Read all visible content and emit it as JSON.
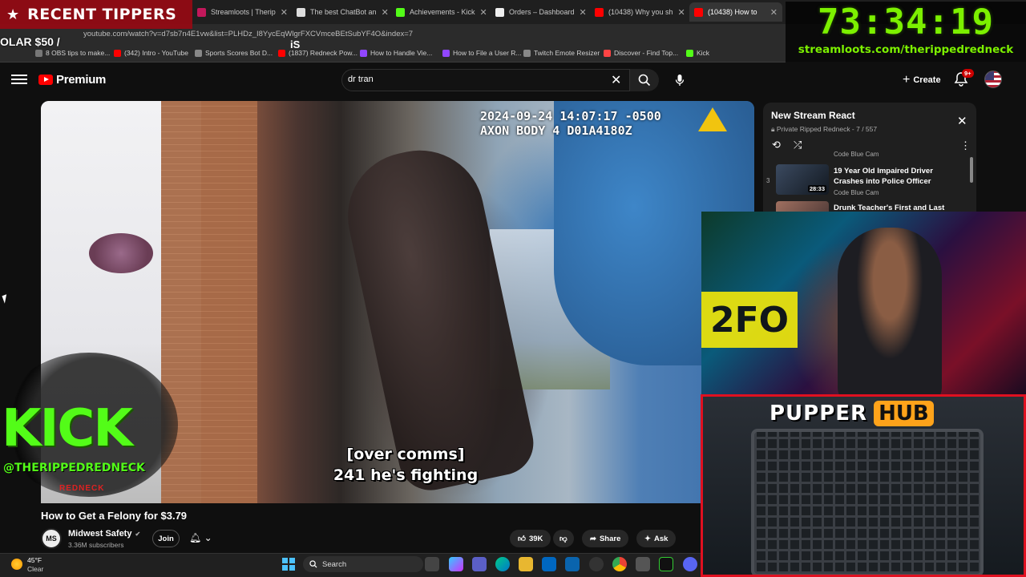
{
  "browser": {
    "tabs": [
      {
        "label": "...",
        "color": "#cc2233"
      },
      {
        "label": "Streamloots | Therip",
        "color": "#c2185b"
      },
      {
        "label": "The best ChatBot an",
        "color": "#dddddd"
      },
      {
        "label": "Achievements - Kick",
        "color": "#53fc18"
      },
      {
        "label": "Orders – Dashboard",
        "color": "#eeeeee"
      },
      {
        "label": "(10438) Why you sh",
        "color": "#ff0000"
      },
      {
        "label": "(10438) How to",
        "color": "#ff0000"
      }
    ],
    "url": "youtube.com/watch?v=d7sb7n4E1vw&list=PLHDz_I8YycEqWlgrFXCVmceBEtSubYF4O&index=7",
    "bookmarks": [
      {
        "label": "8 OBS tips to make...",
        "color": "#777777"
      },
      {
        "label": "(342) Intro - YouTube",
        "color": "#ff0000"
      },
      {
        "label": "Sports Scores Bot D...",
        "color": "#888888"
      },
      {
        "label": "(1837) Redneck Pow...",
        "color": "#ff0000"
      },
      {
        "label": "How to Handle Vie...",
        "color": "#9146ff"
      },
      {
        "label": "How to File a User R...",
        "color": "#9146ff"
      },
      {
        "label": "Twitch Emote Resizer",
        "color": "#888888"
      },
      {
        "label": "Discover - Find Top...",
        "color": "#ff4444"
      },
      {
        "label": "Kick",
        "color": "#53fc18"
      }
    ]
  },
  "overlay": {
    "tippers_title": "RECENT TIPPERS",
    "tipper_entry": "OLAR $50 /",
    "tipper_extra": "iS",
    "timer": "73:34:19",
    "timer_url": "streamloots.com/therippedredneck",
    "kick_word": "KICK",
    "kick_handle": "@THERIPPEDREDNECK",
    "kick_sub": "REDNECK",
    "sign_text": "2FO",
    "pupper_word": "PUPPER",
    "hub_word": "HUB"
  },
  "youtube": {
    "brand": "Premium",
    "search_value": "dr tran",
    "create_label": "Create",
    "notif_count": "9+"
  },
  "video": {
    "axon_line1": "2024-09-24 14:07:17 -0500",
    "axon_line2": "AXON BODY 4 D01A4180Z",
    "caption_line1": "[over comms]",
    "caption_line2": "241 he's fighting",
    "title": "How to Get a Felony for $3.79",
    "channel": "Midwest Safety",
    "channel_initials": "MS",
    "subscribers": "3.36M subscribers",
    "join_label": "Join",
    "likes": "39K",
    "share_label": "Share",
    "ask_label": "Ask"
  },
  "playlist": {
    "title": "New Stream React",
    "subtitle": "Private Ripped Redneck - 7 / 557",
    "items": [
      {
        "num": "",
        "title": "",
        "channel": "Code Blue Cam",
        "duration": ""
      },
      {
        "num": "3",
        "title": "19 Year Old Impaired Driver Crashes into Police Officer",
        "channel": "Code Blue Cam",
        "duration": "28:33"
      },
      {
        "num": "",
        "title": "Drunk Teacher's First and Last",
        "channel": "",
        "duration": ""
      }
    ]
  },
  "taskbar": {
    "temp": "45°F",
    "condition": "Clear",
    "search_label": "Search"
  },
  "colors": {
    "accent_red": "#ff0000",
    "kick_green": "#53fc18",
    "timer_green": "#7cf000",
    "pupper_border": "#e01020"
  }
}
